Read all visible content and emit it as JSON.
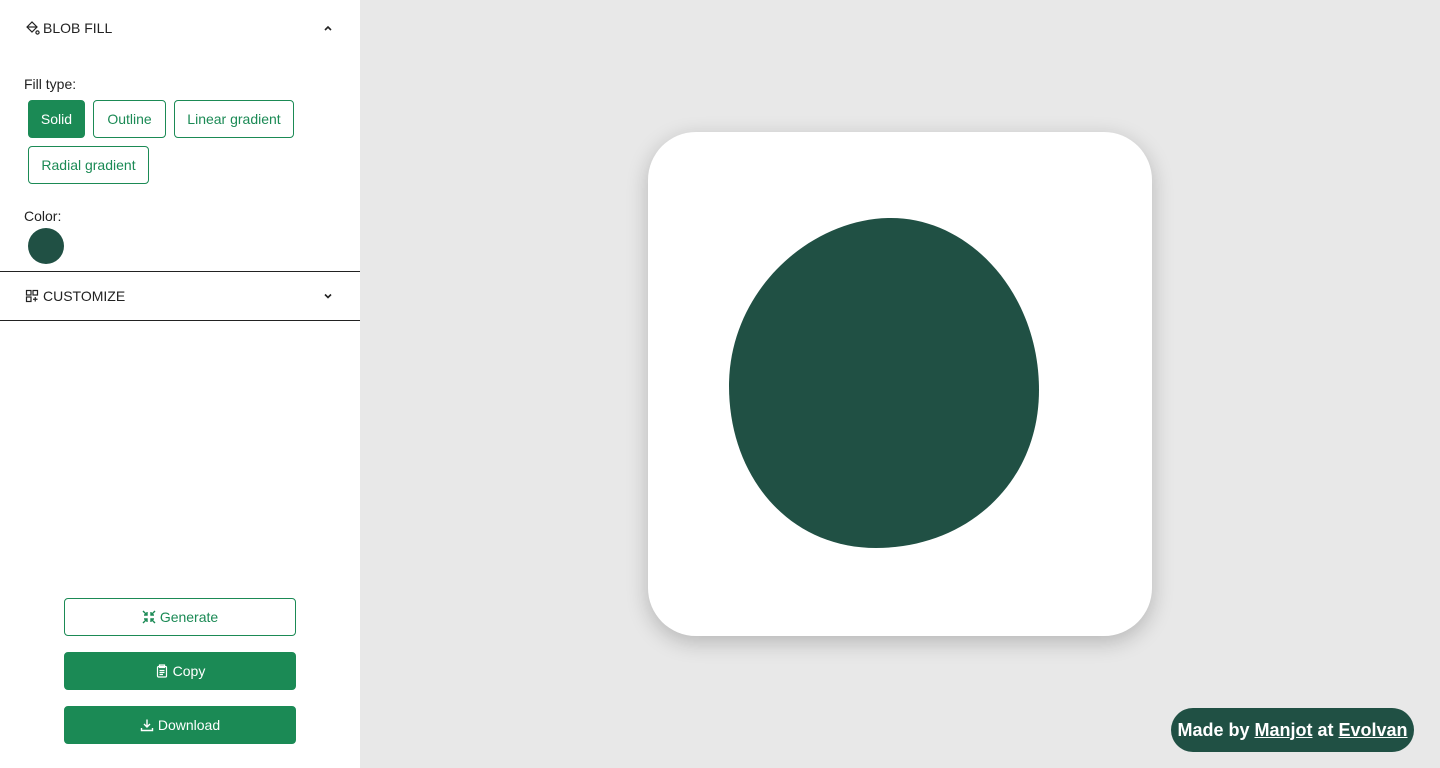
{
  "sidebar": {
    "blob_fill": {
      "title": "BLOB FILL",
      "icon": "paint-bucket-icon",
      "expanded": true,
      "fill_type_label": "Fill type:",
      "fill_types": [
        "Solid",
        "Outline",
        "Linear gradient",
        "Radial gradient"
      ],
      "selected_fill_type": "Solid",
      "color_label": "Color:",
      "color_value": "#205044"
    },
    "customize": {
      "title": "CUSTOMIZE",
      "icon": "grid-icon",
      "expanded": false
    },
    "actions": {
      "generate_label": "Generate",
      "copy_label": "Copy",
      "download_label": "Download"
    }
  },
  "canvas": {
    "blob_color": "#205044",
    "card_color": "#ffffff"
  },
  "credit": {
    "prefix": "Made by",
    "author": "Manjot",
    "middle": "at",
    "company": "Evolvan"
  },
  "colors": {
    "accent": "#1b8a55",
    "blob": "#205044",
    "background": "#e8e8e8"
  }
}
